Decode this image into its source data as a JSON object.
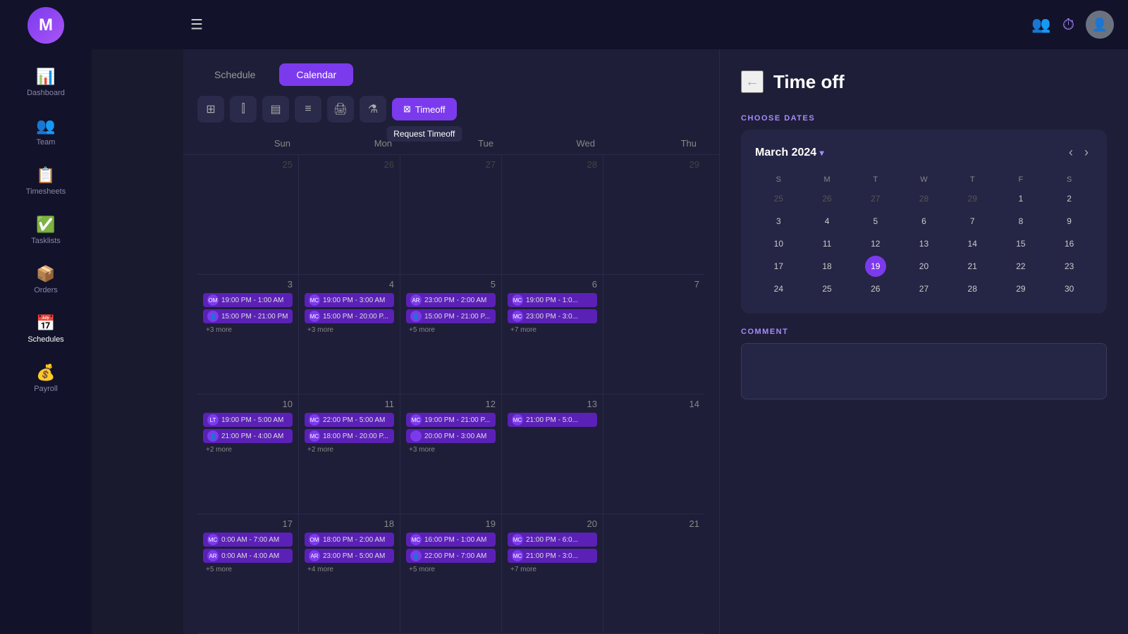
{
  "app": {
    "logo": "M",
    "hamburger_icon": "☰"
  },
  "sidebar": {
    "items": [
      {
        "id": "dashboard",
        "label": "Dashboard",
        "icon": "📊",
        "active": false
      },
      {
        "id": "team",
        "label": "Team",
        "icon": "👥",
        "active": false
      },
      {
        "id": "timesheets",
        "label": "Timesheets",
        "icon": "📋",
        "active": false
      },
      {
        "id": "tasklists",
        "label": "Tasklists",
        "icon": "✅",
        "active": false
      },
      {
        "id": "orders",
        "label": "Orders",
        "icon": "📦",
        "active": false
      },
      {
        "id": "schedules",
        "label": "Schedules",
        "icon": "📅",
        "active": true
      },
      {
        "id": "payroll",
        "label": "Payroll",
        "icon": "💰",
        "active": false
      }
    ]
  },
  "topbar": {
    "users_icon": "👥",
    "timer_icon": "⏱"
  },
  "calendar": {
    "tabs": [
      {
        "id": "schedule",
        "label": "Schedule",
        "active": false
      },
      {
        "id": "calendar",
        "label": "Calendar",
        "active": true
      }
    ],
    "toolbar": {
      "buttons": [
        {
          "id": "grid",
          "icon": "⊞",
          "active": false
        },
        {
          "id": "columns",
          "icon": "⫿",
          "active": false
        },
        {
          "id": "table",
          "icon": "▤",
          "active": false
        },
        {
          "id": "list",
          "icon": "≡",
          "active": false
        },
        {
          "id": "print",
          "icon": "🖨",
          "active": false
        },
        {
          "id": "filter",
          "icon": "⚗",
          "active": false
        }
      ],
      "timeoff_button": "Timeoff",
      "timeoff_tooltip": "Request Timeoff"
    },
    "day_headers": [
      "Sun",
      "Mon",
      "Tue",
      "Wed",
      "Thu"
    ],
    "weeks": [
      {
        "days": [
          {
            "num": "25",
            "other": true,
            "events": [],
            "more": null
          },
          {
            "num": "26",
            "other": true,
            "events": [],
            "more": null
          },
          {
            "num": "27",
            "other": true,
            "events": [],
            "more": null
          },
          {
            "num": "28",
            "other": true,
            "events": [],
            "more": null
          },
          {
            "num": "29",
            "other": true,
            "events": [],
            "more": null
          }
        ]
      },
      {
        "days": [
          {
            "num": "3",
            "other": false,
            "events": [
              {
                "time": "19:00 PM - 1:00 AM",
                "avatar": "OM",
                "color": "#5b21b6"
              },
              {
                "time": "15:00 PM - 21:00 PM",
                "avatar": "👤",
                "color": "#5b21b6"
              }
            ],
            "more": "+3 more"
          },
          {
            "num": "4",
            "other": false,
            "events": [
              {
                "time": "19:00 PM - 3:00 AM",
                "avatar": "MC",
                "color": "#5b21b6"
              },
              {
                "time": "15:00 PM - 20:00 P...",
                "avatar": "MC",
                "color": "#5b21b6"
              }
            ],
            "more": "+3 more"
          },
          {
            "num": "5",
            "other": false,
            "events": [
              {
                "time": "23:00 PM - 2:00 AM",
                "avatar": "AR",
                "color": "#5b21b6"
              },
              {
                "time": "15:00 PM - 21:00 P...",
                "avatar": "👤",
                "color": "#5b21b6"
              }
            ],
            "more": "+5 more"
          },
          {
            "num": "6",
            "other": false,
            "events": [
              {
                "time": "19:00 PM - 1:0...",
                "avatar": "MC",
                "color": "#5b21b6"
              },
              {
                "time": "23:00 PM - 3:0...",
                "avatar": "MC",
                "color": "#5b21b6"
              }
            ],
            "more": "+7 more"
          },
          {
            "num": "7",
            "other": false,
            "events": [],
            "more": null
          }
        ]
      },
      {
        "days": [
          {
            "num": "10",
            "other": false,
            "events": [
              {
                "time": "19:00 PM - 5:00 AM",
                "avatar": "LT",
                "color": "#5b21b6"
              },
              {
                "time": "21:00 PM - 4:00 AM",
                "avatar": "👤",
                "color": "#5b21b6"
              }
            ],
            "more": "+2 more"
          },
          {
            "num": "11",
            "other": false,
            "events": [
              {
                "time": "22:00 PM - 5:00 AM",
                "avatar": "MC",
                "color": "#5b21b6"
              },
              {
                "time": "18:00 PM - 20:00 P...",
                "avatar": "MC",
                "color": "#5b21b6"
              }
            ],
            "more": "+2 more"
          },
          {
            "num": "12",
            "other": false,
            "events": [
              {
                "time": "19:00 PM - 21:00 P...",
                "avatar": "MC",
                "color": "#5b21b6"
              },
              {
                "time": "20:00 PM - 3:00 AM",
                "avatar": "",
                "color": "#5b21b6"
              }
            ],
            "more": "+3 more"
          },
          {
            "num": "13",
            "other": false,
            "events": [
              {
                "time": "21:00 PM - 5:0...",
                "avatar": "MC",
                "color": "#5b21b6"
              }
            ],
            "more": null
          },
          {
            "num": "14",
            "other": false,
            "events": [],
            "more": null
          }
        ]
      },
      {
        "days": [
          {
            "num": "17",
            "other": false,
            "events": [
              {
                "time": "0:00 AM - 7:00 AM",
                "avatar": "MC",
                "color": "#5b21b6"
              },
              {
                "time": "0:00 AM - 4:00 AM",
                "avatar": "AR",
                "color": "#5b21b6"
              }
            ],
            "more": "+5 more"
          },
          {
            "num": "18",
            "other": false,
            "events": [
              {
                "time": "18:00 PM - 2:00 AM",
                "avatar": "OM",
                "color": "#5b21b6"
              },
              {
                "time": "23:00 PM - 5:00 AM",
                "avatar": "AR",
                "color": "#5b21b6"
              }
            ],
            "more": "+4 more"
          },
          {
            "num": "19",
            "other": false,
            "events": [
              {
                "time": "16:00 PM - 1:00 AM",
                "avatar": "MC",
                "color": "#5b21b6"
              },
              {
                "time": "22:00 PM - 7:00 AM",
                "avatar": "👤",
                "color": "#5b21b6"
              }
            ],
            "more": "+5 more"
          },
          {
            "num": "20",
            "other": false,
            "events": [
              {
                "time": "21:00 PM - 6:0...",
                "avatar": "MC",
                "color": "#5b21b6"
              },
              {
                "time": "21:00 PM - 3:0...",
                "avatar": "MC",
                "color": "#5b21b6"
              }
            ],
            "more": "+7 more"
          },
          {
            "num": "21",
            "other": false,
            "events": [],
            "more": null
          }
        ]
      }
    ]
  },
  "timeoff_panel": {
    "back_label": "←",
    "title": "Time off",
    "choose_dates_label": "CHOOSE DATES",
    "mini_calendar": {
      "month_year": "March 2024",
      "dropdown_icon": "▾",
      "prev_icon": "‹",
      "next_icon": "›",
      "day_headers": [
        "S",
        "M",
        "T",
        "W",
        "T",
        "F",
        "S"
      ],
      "weeks": [
        [
          "25",
          "26",
          "27",
          "28",
          "29",
          "1",
          "2"
        ],
        [
          "3",
          "4",
          "5",
          "6",
          "7",
          "8",
          "9"
        ],
        [
          "10",
          "11",
          "12",
          "13",
          "14",
          "15",
          "16"
        ],
        [
          "17",
          "18",
          "19",
          "20",
          "21",
          "22",
          "23"
        ],
        [
          "24",
          "25",
          "26",
          "27",
          "28",
          "29",
          "30"
        ]
      ],
      "today": "19",
      "other_month_days": [
        "25",
        "26",
        "27",
        "28",
        "29"
      ]
    },
    "comment_label": "COMMENT",
    "comment_placeholder": ""
  }
}
